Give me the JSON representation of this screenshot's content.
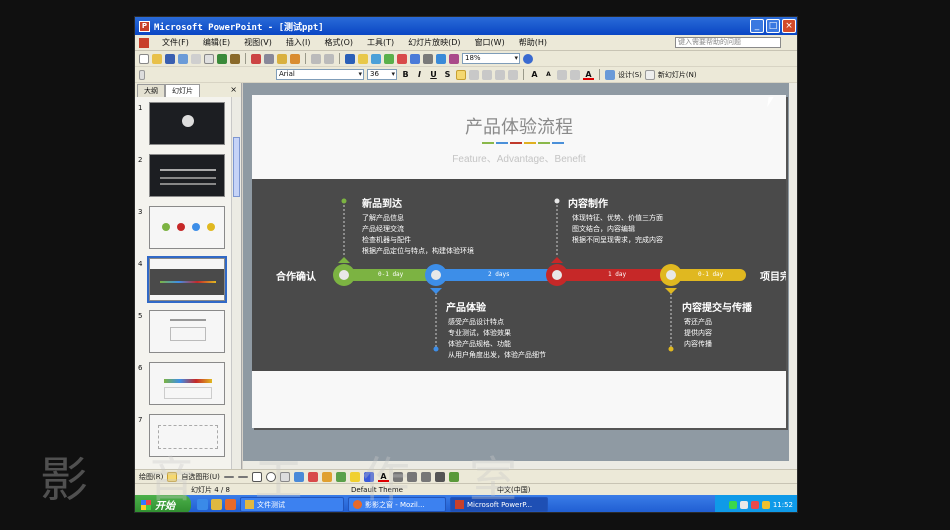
{
  "window": {
    "title": "Microsoft PowerPoint - [测试ppt]"
  },
  "menu": [
    "文件(F)",
    "编辑(E)",
    "视图(V)",
    "插入(I)",
    "格式(O)",
    "工具(T)",
    "幻灯片放映(D)",
    "窗口(W)",
    "帮助(H)"
  ],
  "help_placeholder": "键入需要帮助的问题",
  "toolbar": {
    "zoom": "18%",
    "font": "Arial",
    "size": "36",
    "bold": "B",
    "italic": "I",
    "underline": "U",
    "shadow": "S",
    "design": "设计(S)",
    "new_slide": "新幻灯片(N)"
  },
  "panel": {
    "tab_outline": "大纲",
    "tab_slides": "幻灯片",
    "close": "×",
    "thumbnails": [
      {
        "n": "1",
        "style": "dark"
      },
      {
        "n": "2",
        "style": "dark"
      },
      {
        "n": "3",
        "style": "light"
      },
      {
        "n": "4",
        "style": "dark-band",
        "selected": true
      },
      {
        "n": "5",
        "style": "light"
      },
      {
        "n": "6",
        "style": "light"
      },
      {
        "n": "7",
        "style": "light"
      }
    ]
  },
  "slide": {
    "title": "产品体验流程",
    "subtitle": "Feature、Advantage、Benefit",
    "accent_colors": [
      "#8ab84a",
      "#4a90d9",
      "#c0392b",
      "#e0b020",
      "#8ab84a",
      "#4a90d9"
    ],
    "left_label": "合作确认",
    "right_label": "项目完",
    "segments": [
      {
        "label": "0-1 day",
        "color": "#7cb342"
      },
      {
        "label": "2 days",
        "color": "#3d8ee8"
      },
      {
        "label": "1 day",
        "color": "#c62828"
      },
      {
        "label": "0-1 day",
        "color": "#e0b820"
      }
    ],
    "steps": [
      {
        "title": "新品到达",
        "items": [
          "了解产品信息",
          "产品经理交流",
          "检查机器与配件",
          "根据产品定位与特点，构建体验环境"
        ]
      },
      {
        "title": "产品体验",
        "items": [
          "感受产品设计特点",
          "专业测试，体验效果",
          "体验产品规格、功能",
          "从用户角度出发，体验产品细节"
        ]
      },
      {
        "title": "内容制作",
        "items": [
          "体现特征、优势、价值三方面",
          "图文结合，内容编辑",
          "根据不同呈现需求，完成内容"
        ]
      },
      {
        "title": "内容提交与传播",
        "items": [
          "寄还产品",
          "提供内容",
          "内容传播"
        ]
      }
    ]
  },
  "drawbar": {
    "draw": "绘图(R)",
    "autoshapes": "自选图形(U)"
  },
  "status": {
    "slide_of": "幻灯片 4 / 8",
    "theme": "Default Theme",
    "lang": "中文(中国)"
  },
  "taskbar": {
    "start": "开始",
    "tasks": [
      "文件测试",
      "影影之窗 - Mozil...",
      "Microsoft PowerP..."
    ],
    "clock": "11:52"
  },
  "watermark": "影 音 工 作 室"
}
